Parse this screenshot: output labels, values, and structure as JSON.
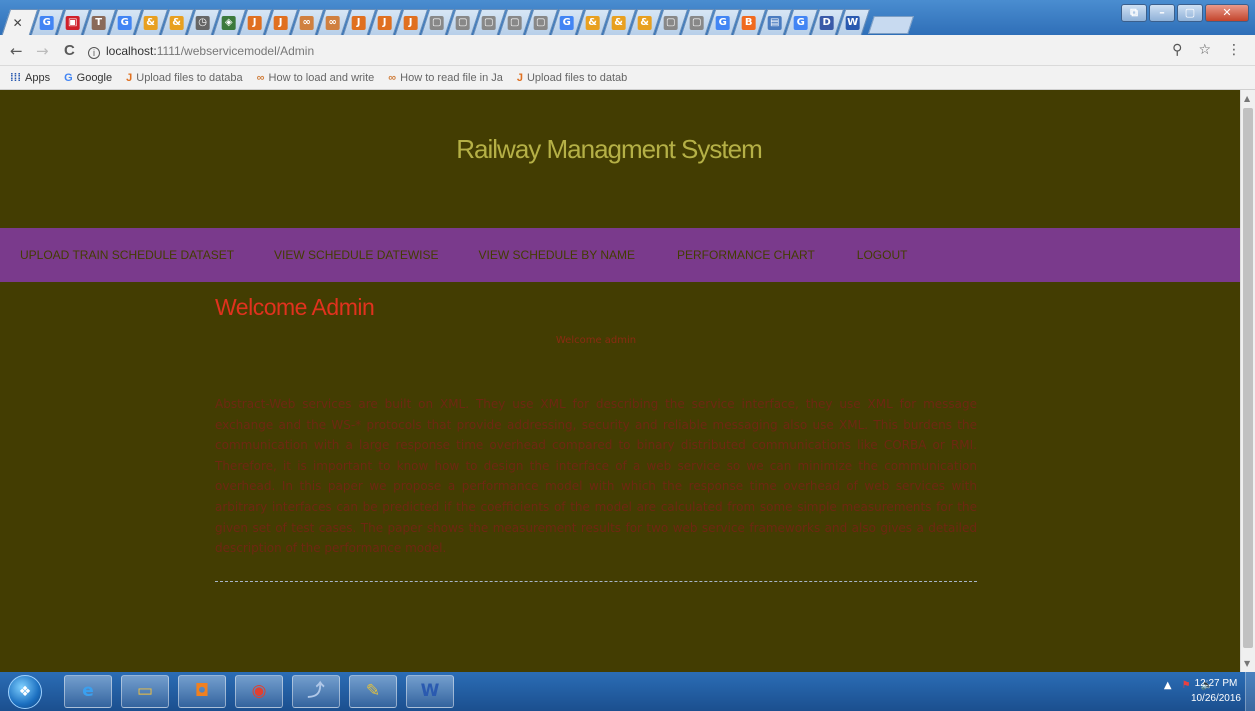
{
  "browser": {
    "tabs": [
      {
        "icon": "G",
        "color": "#4285f4"
      },
      {
        "icon": "▣",
        "color": "#d0202a"
      },
      {
        "icon": "T",
        "color": "#8a6a5a"
      },
      {
        "icon": "G",
        "color": "#4285f4"
      },
      {
        "icon": "&",
        "color": "#e8a020"
      },
      {
        "icon": "&",
        "color": "#e8a020"
      },
      {
        "icon": "◷",
        "color": "#666666"
      },
      {
        "icon": "◈",
        "color": "#3c7a3c"
      },
      {
        "icon": "J",
        "color": "#e07020"
      },
      {
        "icon": "J",
        "color": "#e07020"
      },
      {
        "icon": "∞",
        "color": "#d08040"
      },
      {
        "icon": "∞",
        "color": "#d08040"
      },
      {
        "icon": "J",
        "color": "#e07020"
      },
      {
        "icon": "J",
        "color": "#e07020"
      },
      {
        "icon": "J",
        "color": "#e07020"
      },
      {
        "icon": "▢",
        "color": "#888888"
      },
      {
        "icon": "▢",
        "color": "#888888"
      },
      {
        "icon": "▢",
        "color": "#888888"
      },
      {
        "icon": "▢",
        "color": "#888888"
      },
      {
        "icon": "▢",
        "color": "#888888"
      },
      {
        "icon": "G",
        "color": "#4285f4"
      },
      {
        "icon": "&",
        "color": "#e8a020"
      },
      {
        "icon": "&",
        "color": "#e8a020"
      },
      {
        "icon": "&",
        "color": "#e8a020"
      },
      {
        "icon": "▢",
        "color": "#888888"
      },
      {
        "icon": "▢",
        "color": "#888888"
      },
      {
        "icon": "G",
        "color": "#4285f4"
      },
      {
        "icon": "B",
        "color": "#f06a20"
      },
      {
        "icon": "▤",
        "color": "#4a7cc0"
      },
      {
        "icon": "G",
        "color": "#4285f4"
      },
      {
        "icon": "D",
        "color": "#3a5aa8"
      },
      {
        "icon": "W",
        "color": "#2a5ab0"
      }
    ],
    "active_tab_icon": "✕",
    "window_buttons": {
      "restore": "⧉",
      "minimize": "–",
      "maximize": "▢",
      "close": "✕"
    },
    "nav": {
      "back": "←",
      "forward": "→",
      "reload": "C"
    },
    "url_host": "localhost:",
    "url_rest": "1111/webservicemodel/Admin",
    "addr_icons": {
      "key": "⚲",
      "star": "☆",
      "menu": "⋮"
    },
    "bookmarks": [
      {
        "icon": "⁞⁞⁞",
        "label": "Apps",
        "color": "#2a5ab0"
      },
      {
        "icon": "G",
        "label": "Google",
        "color": "#4285f4"
      },
      {
        "icon": "J",
        "label": "Upload files to databa",
        "color": "#e07020"
      },
      {
        "icon": "∞",
        "label": "How to load and write",
        "color": "#d08040"
      },
      {
        "icon": "∞",
        "label": "How to read file in Ja",
        "color": "#d08040"
      },
      {
        "icon": "J",
        "label": "Upload files to datab",
        "color": "#e07020"
      }
    ]
  },
  "site": {
    "title": "Railway Managment System",
    "menu": [
      "UPLOAD TRAIN SCHEDULE DATASET",
      "VIEW SCHEDULE DATEWISE",
      "VIEW SCHEDULE BY NAME",
      "PERFORMANCE CHART",
      "LOGOUT"
    ],
    "heading": "Welcome Admin",
    "subheading": "Welcome admin",
    "abstract": "Abstract-Web services are built on XML. They use XML for describing the service interface, they use XML for message exchange and the WS-* protocols that provide addressing, security and reliable messaging also use XML. This burdens the communication with a large response time overhead compared to binary distributed communications like CORBA or RMI. Therefore, it is important to know how to design the interface of a web service so we can minimize the communication overhead. In this paper we propose a performance model with which the response time overhead of web services with arbitrary interfaces can be predicted if the coefficients of the model are calculated from some simple measurements for the given set of test cases. The paper shows the measurement results for two web service frameworks and also gives a detailed description of the performance model.",
    "colors": {
      "background": "#433d02",
      "title": "#b5b046",
      "menu_bg": "#7a3a8c",
      "heading": "#e0321e",
      "body_text": "#6e2712"
    }
  },
  "taskbar": {
    "start_icon": "❖",
    "apps": [
      {
        "name": "internet-explorer",
        "glyph": "e",
        "color": "#3aa0f0"
      },
      {
        "name": "file-explorer",
        "glyph": "▭",
        "color": "#f0c040"
      },
      {
        "name": "media-player",
        "glyph": "◘",
        "color": "#f08020"
      },
      {
        "name": "chrome",
        "glyph": "◉",
        "color": "#e04030"
      },
      {
        "name": "dolphin",
        "glyph": "⤴",
        "color": "#b0c8e8"
      },
      {
        "name": "tools",
        "glyph": "✎",
        "color": "#e0c040"
      },
      {
        "name": "word",
        "glyph": "W",
        "color": "#2a5ab0"
      }
    ],
    "tray_icons": {
      "up": "▲",
      "flag": "⚑",
      "volume": "🔈"
    },
    "time": "12:27 PM",
    "date": "10/26/2016"
  }
}
